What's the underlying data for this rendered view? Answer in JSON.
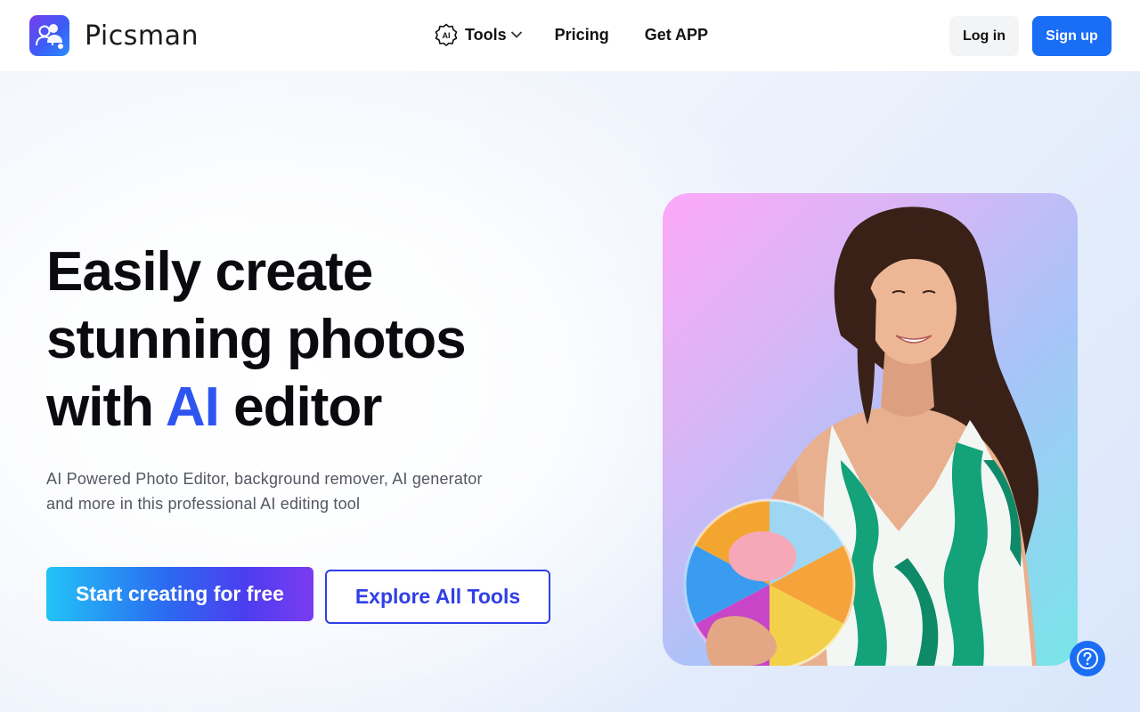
{
  "brand": {
    "name": "Picsman"
  },
  "nav": {
    "tools": "Tools",
    "pricing": "Pricing",
    "get_app": "Get APP",
    "tools_icon_text": "AI"
  },
  "auth": {
    "login": "Log in",
    "signup": "Sign up"
  },
  "hero": {
    "title_line1": "Easily create",
    "title_line2": "stunning photos",
    "title_line3_pre": "with ",
    "title_line3_ai": "AI",
    "title_line3_post": " editor",
    "subtitle_line1": "AI Powered Photo Editor, background remover, AI generator",
    "subtitle_line2": "and more in this professional AI editing tool",
    "cta_primary": "Start creating for free",
    "cta_secondary": "Explore All Tools"
  },
  "icons": {
    "logo": "user-group-logo-icon",
    "tools": "ai-badge-icon",
    "dropdown": "chevron-down-icon",
    "help": "question-circle-icon"
  },
  "colors": {
    "primary": "#1a6df5",
    "accent_ai": "#2f55f0",
    "explore_border": "#2f3fe6",
    "title": "#0b0b0f",
    "subtitle": "#545761"
  }
}
